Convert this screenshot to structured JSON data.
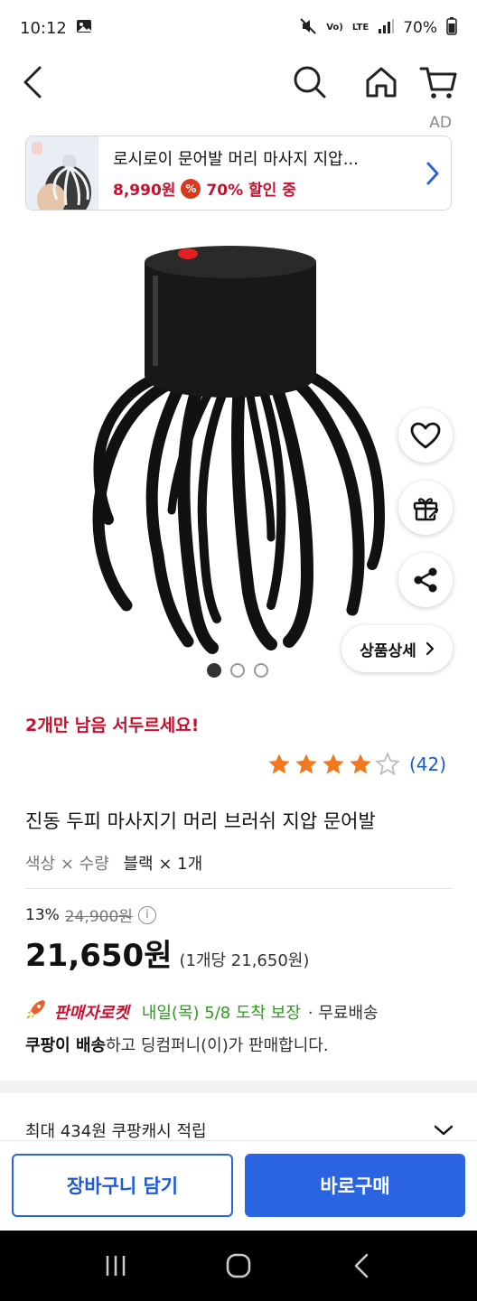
{
  "status_bar": {
    "time": "10:12",
    "volte_label": "Vo)",
    "lte_label": "LTE",
    "battery": "70%"
  },
  "header": {
    "icons": [
      "back-arrow-icon",
      "search-icon",
      "home-icon",
      "cart-icon"
    ]
  },
  "ad": {
    "label": "AD",
    "title": "로시로이 문어발 머리 마사지 지압...",
    "price": "8,990원",
    "discount_badge": "%",
    "discount_text": "70% 할인 중"
  },
  "product": {
    "hurry_text": "2개만 남음 서두르세요!",
    "rating_stars": 4,
    "rating_max": 5,
    "review_count": "(42)",
    "title": "진동 두피 마사지기 머리 브러쉬 지압 문어발",
    "option_label": "색상 × 수량",
    "option_value": "블랙 × 1개",
    "discount_pct": "13%",
    "original_price": "24,900원",
    "info_icon": "i",
    "price": "21,650원",
    "unit_price": "(1개당 21,650원)",
    "rocket_label": "판매자로켓",
    "eta": "내일(목) 5/8 도착 보장",
    "free_shipping": " · 무료배송",
    "seller_bold": "쿠팡이 배송",
    "seller_text": "하고 딩컴퍼니(이)가 판매합니다.",
    "cash_text": "최대 434원 쿠팡캐시 적립",
    "detail_label": "상품상세",
    "image_count": 3,
    "image_index": 0
  },
  "bottom": {
    "cart_label": "장바구니 담기",
    "buy_label": "바로구매"
  },
  "colors": {
    "accent_blue": "#2a64e0",
    "sale_red": "#c8102e",
    "delivery_green": "#2e9a1e",
    "star_orange": "#f0781e"
  }
}
